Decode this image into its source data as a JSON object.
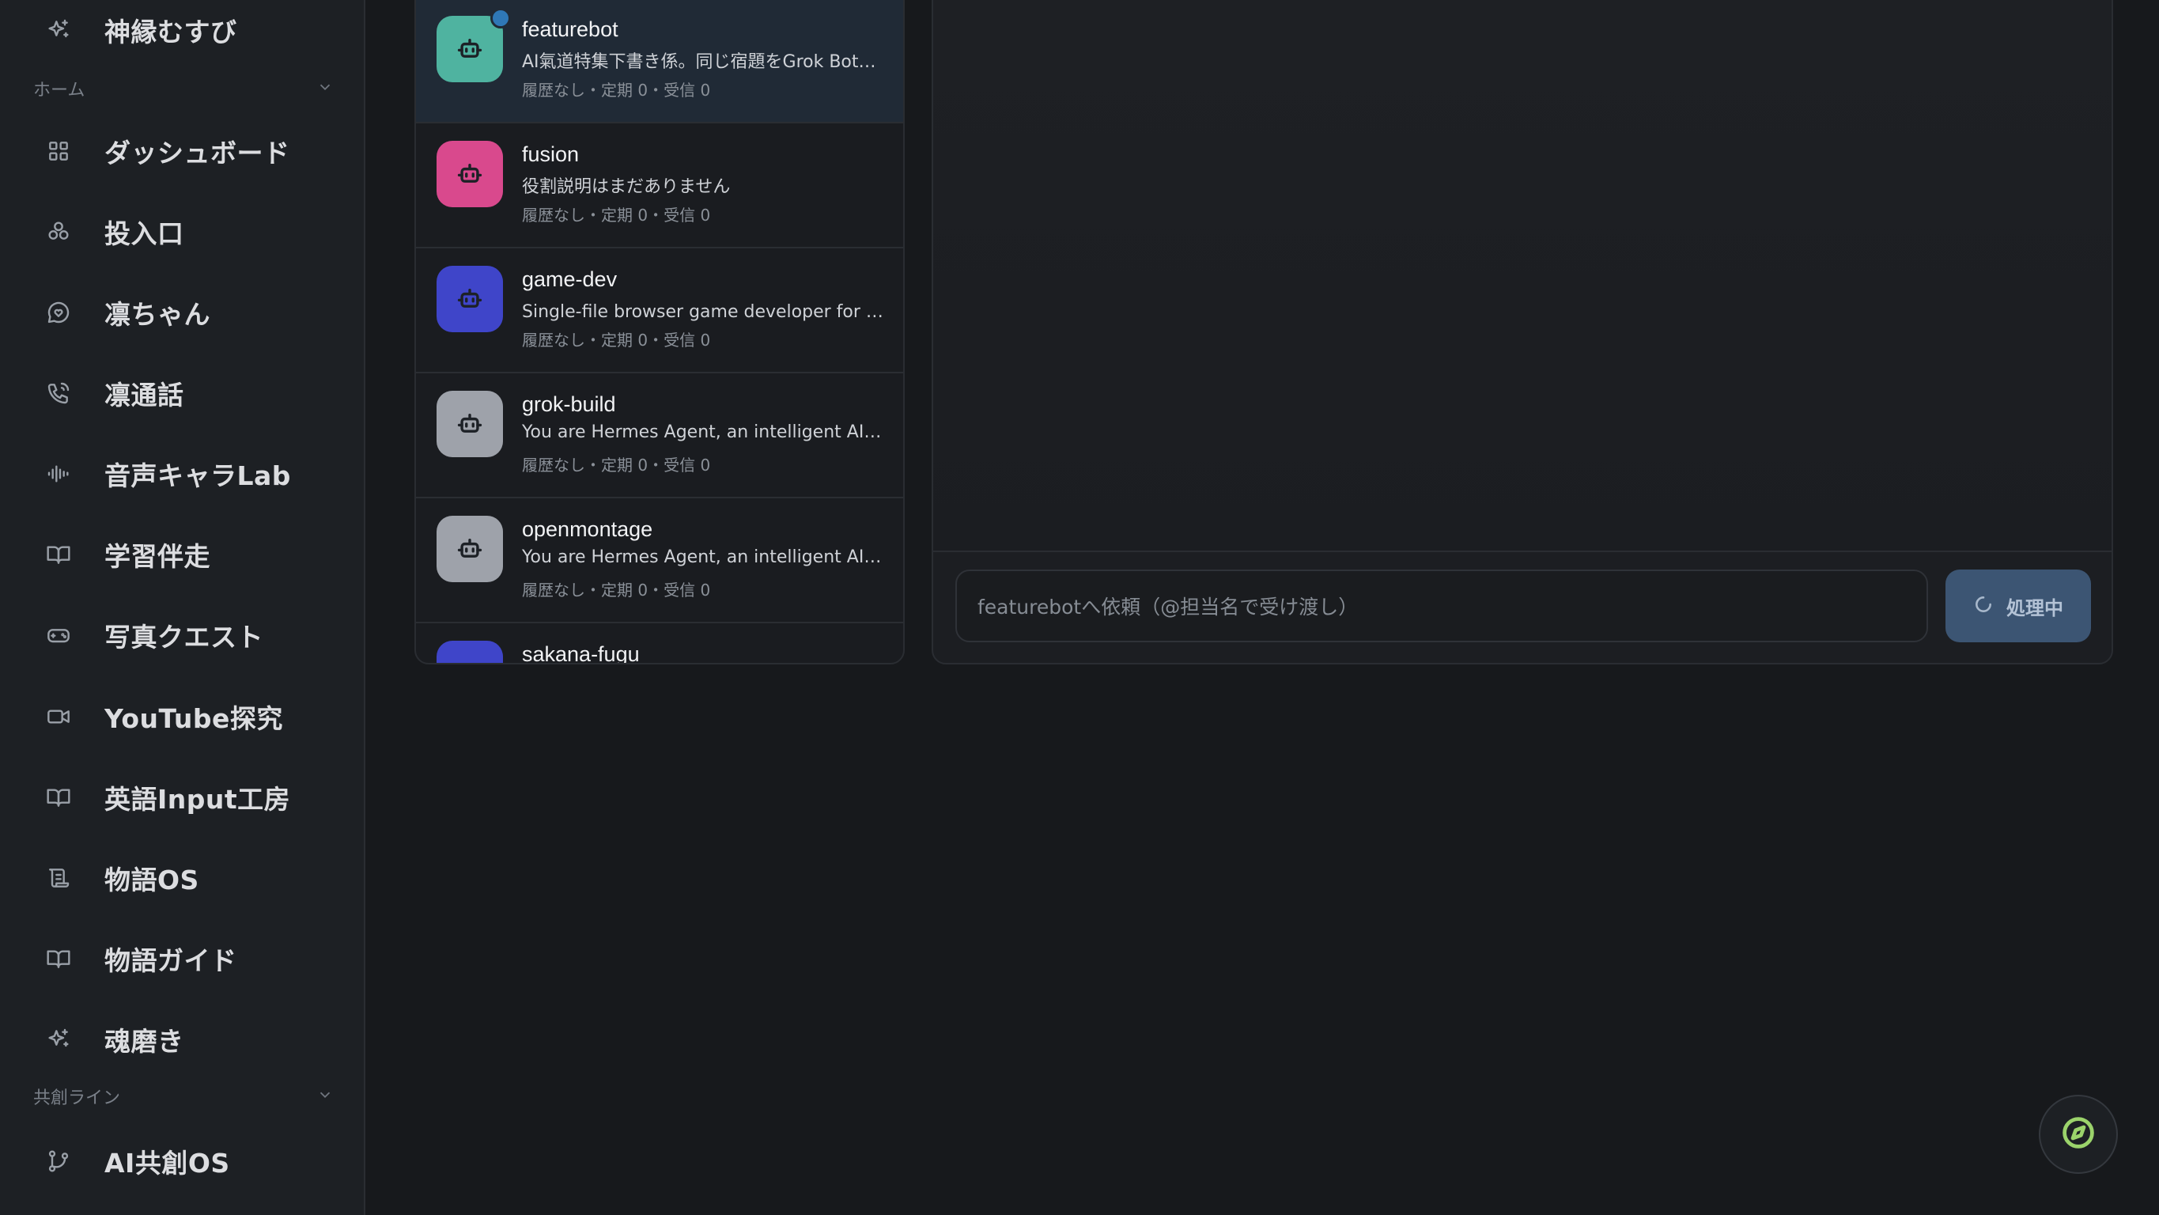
{
  "sidebar": {
    "top_item": {
      "label": "神縁むすび",
      "icon": "sparkles-icon"
    },
    "groups": [
      {
        "label": "ホーム"
      },
      {
        "label": "共創ライン"
      }
    ],
    "items": [
      {
        "label": "ダッシュボード",
        "icon": "grid-icon"
      },
      {
        "label": "投入口",
        "icon": "shapes-icon"
      },
      {
        "label": "凛ちゃん",
        "icon": "heart-chat-icon"
      },
      {
        "label": "凛通話",
        "icon": "phone-icon"
      },
      {
        "label": "音声キャラLab",
        "icon": "audio-wave-icon"
      },
      {
        "label": "学習伴走",
        "icon": "book-icon"
      },
      {
        "label": "写真クエスト",
        "icon": "gamepad-icon"
      },
      {
        "label": "YouTube探究",
        "icon": "video-icon"
      },
      {
        "label": "英語Input工房",
        "icon": "book-icon"
      },
      {
        "label": "物語OS",
        "icon": "scroll-icon"
      },
      {
        "label": "物語ガイド",
        "icon": "book-icon"
      },
      {
        "label": "魂磨き",
        "icon": "sparkles-icon"
      },
      {
        "label": "AI共創OS",
        "icon": "git-branch-icon"
      }
    ]
  },
  "agents": [
    {
      "name": "featurebot",
      "desc": "AI氣道特集下書き係。同じ宿題をGrok Botと…",
      "meta": "履歴なし・定期 0・受信 0",
      "color": "#4fb3a0",
      "selected": true
    },
    {
      "name": "fusion",
      "desc": "役割説明はまだありません",
      "meta": "履歴なし・定期 0・受信 0",
      "color": "#d9498d",
      "selected": false
    },
    {
      "name": "game-dev",
      "desc": "Single-file browser game developer for AI共…",
      "meta": "履歴なし・定期 0・受信 0",
      "color": "#3f45c9",
      "selected": false
    },
    {
      "name": "grok-build",
      "desc": "You are Hermes Agent, an intelligent AI assis…",
      "meta": "履歴なし・定期 0・受信 0",
      "color": "#9ea2aa",
      "selected": false
    },
    {
      "name": "openmontage",
      "desc": "You are Hermes Agent, an intelligent AI assis…",
      "meta": "履歴なし・定期 0・受信 0",
      "color": "#9ea2aa",
      "selected": false
    },
    {
      "name": "sakana-fugu",
      "desc": "",
      "meta": "",
      "color": "#3f45c9",
      "selected": false
    }
  ],
  "chat": {
    "input_placeholder": "featurebotへ依頼（@担当名で受け渡し）",
    "send_label": "処理中"
  },
  "fab": {
    "icon": "compass-icon"
  }
}
